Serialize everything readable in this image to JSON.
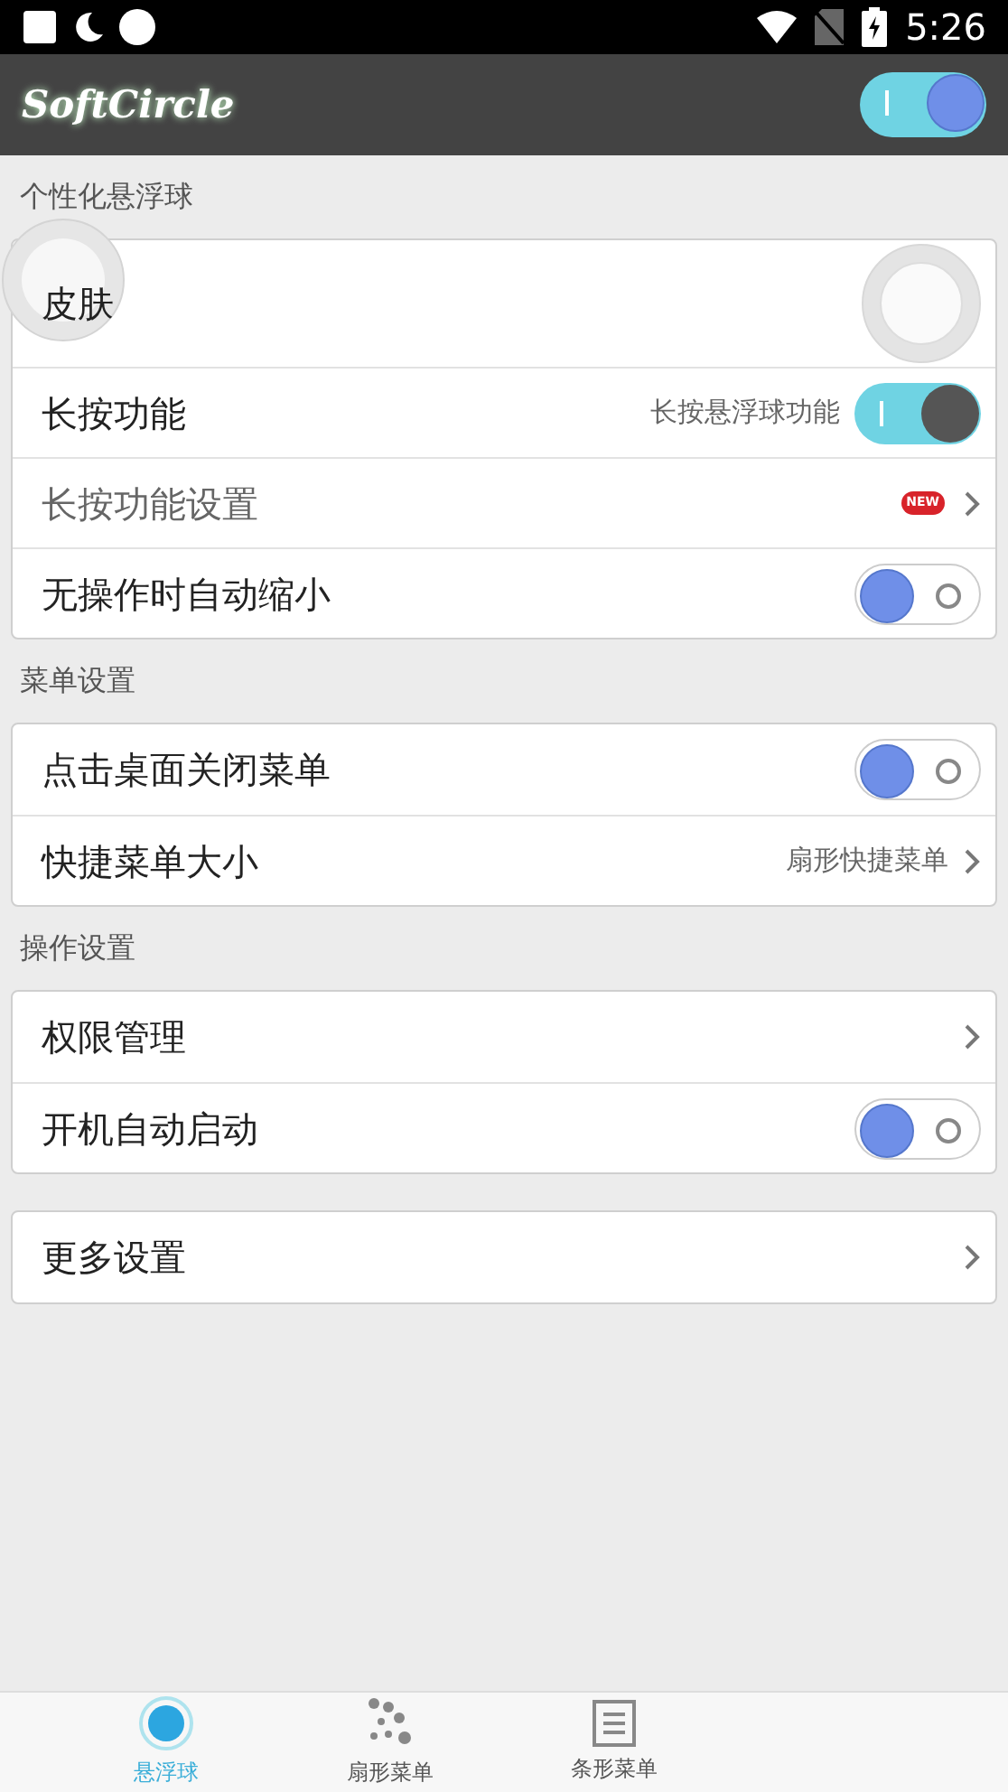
{
  "status_bar": {
    "time": "5:26"
  },
  "app_bar": {
    "logo": "SoftCircle",
    "master_switch": {
      "on": true
    }
  },
  "sections": [
    {
      "title": "个性化悬浮球",
      "items": [
        {
          "kind": "skin",
          "label": "皮肤"
        },
        {
          "kind": "toggle",
          "label": "长按功能",
          "value": "长按悬浮球功能",
          "on": true
        },
        {
          "kind": "link",
          "label": "长按功能设置",
          "badge": "NEW",
          "disabled": true
        },
        {
          "kind": "toggle",
          "label": "无操作时自动缩小",
          "on": false
        }
      ]
    },
    {
      "title": "菜单设置",
      "items": [
        {
          "kind": "toggle",
          "label": "点击桌面关闭菜单",
          "on": false
        },
        {
          "kind": "link",
          "label": "快捷菜单大小",
          "value": "扇形快捷菜单",
          "disabled": false
        }
      ]
    },
    {
      "title": "操作设置",
      "items": [
        {
          "kind": "link",
          "label": "权限管理",
          "disabled": false
        },
        {
          "kind": "toggle",
          "label": "开机自动启动",
          "on": false
        }
      ]
    },
    {
      "items": [
        {
          "kind": "link",
          "label": "更多设置",
          "disabled": false
        }
      ]
    }
  ],
  "bottom_nav": [
    {
      "label": "悬浮球",
      "kind": "ball",
      "selected": true
    },
    {
      "label": "扇形菜单",
      "kind": "fan",
      "selected": false
    },
    {
      "label": "条形菜单",
      "kind": "bar",
      "selected": false
    }
  ]
}
